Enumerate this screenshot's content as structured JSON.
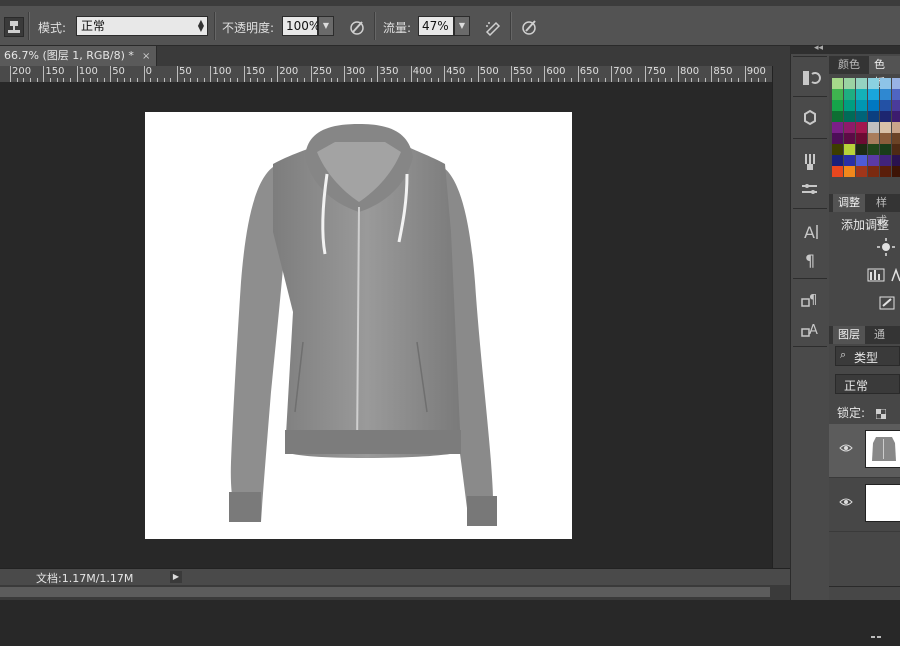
{
  "options_bar": {
    "mode_label": "模式:",
    "mode_value": "正常",
    "opacity_label": "不透明度:",
    "opacity_value": "100%",
    "flow_label": "流量:",
    "flow_value": "47%"
  },
  "document_tab": {
    "title": "66.7% (图层 1, RGB/8) *",
    "close": "×"
  },
  "ruler": {
    "labels": [
      "200",
      "150",
      "100",
      "50",
      "0",
      "50",
      "100",
      "150",
      "200",
      "250",
      "300",
      "350",
      "400",
      "450",
      "500",
      "550",
      "600",
      "650",
      "700",
      "750",
      "800",
      "850",
      "900"
    ]
  },
  "status_bar": {
    "doc_size": "文档:1.17M/1.17M",
    "play": "▶"
  },
  "panels": {
    "color_tab": "颜色",
    "swatches_tab": "色板",
    "adjust_tab": "调整",
    "style_tab": "样式",
    "add_adjustment": "添加调整",
    "layers_tab": "图层",
    "channels_tab": "通道",
    "filter_kind": "类型",
    "blend_mode": "正常",
    "lock_label": "锁定:"
  },
  "swatch_colors": [
    [
      "#a6d98a",
      "#9bd3a3",
      "#94d3c1",
      "#8ad1e1",
      "#8ec4e8",
      "#99b3e4"
    ],
    [
      "#3fb34f",
      "#1fae81",
      "#14b1b8",
      "#1aa6db",
      "#2f88d1",
      "#4f65c2"
    ],
    [
      "#16a44a",
      "#009e82",
      "#0097b3",
      "#0078c1",
      "#2351a5",
      "#4a3b9a"
    ],
    [
      "#0e6e32",
      "#006b58",
      "#006478",
      "#0b3f80",
      "#1d2670",
      "#3c1c6e"
    ],
    [
      "#7a1f88",
      "#8e1a6a",
      "#a3174f",
      "#c0c0c0",
      "#d9c2a8",
      "#c9a58a"
    ],
    [
      "#4d0d58",
      "#5c0b45",
      "#6c0b33",
      "#a97d5c",
      "#8a5d3b",
      "#6b4326"
    ],
    [
      "#3d3d00",
      "#b7d33a",
      "#1c2c14",
      "#21461a",
      "#193d1a",
      "#4e2a14"
    ],
    [
      "#18207a",
      "#2a2fa6",
      "#4e5bd6",
      "#5b3aa5",
      "#41237b",
      "#2a124f"
    ],
    [
      "#e8471e",
      "#f2881c",
      "#a0361a",
      "#7a2a10",
      "#5a1e0a",
      "#3d1406"
    ]
  ]
}
